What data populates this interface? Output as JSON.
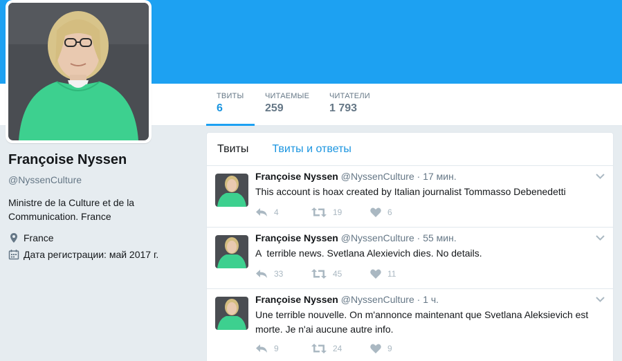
{
  "profile": {
    "name": "Françoise Nyssen",
    "handle": "@NyssenCulture",
    "bio": "Ministre de la Culture et de la Communication. France",
    "location": "France",
    "joined": "Дата регистрации: май 2017 г.",
    "icons": [
      "location-pin-icon",
      "calendar-icon"
    ]
  },
  "stats": [
    {
      "label": "ТВИТЫ",
      "value": "6"
    },
    {
      "label": "ЧИТАЕМЫЕ",
      "value": "259"
    },
    {
      "label": "ЧИТАТЕЛИ",
      "value": "1 793"
    }
  ],
  "tabs": {
    "tweets": "Твиты",
    "replies": "Твиты и ответы"
  },
  "tweets": [
    {
      "name": "Françoise Nyssen",
      "handle": "@NyssenCulture",
      "time": "· 17 мин.",
      "text": "This account is hoax created by Italian journalist Tommasso Debenedetti",
      "replies": "4",
      "retweets": "19",
      "likes": "6"
    },
    {
      "name": "Françoise Nyssen",
      "handle": "@NyssenCulture",
      "time": "· 55 мин.",
      "text": "A  terrible news. Svetlana Alexievich dies. No details.",
      "replies": "33",
      "retweets": "45",
      "likes": "11"
    },
    {
      "name": "Françoise Nyssen",
      "handle": "@NyssenCulture",
      "time": "· 1 ч.",
      "text": "Une terrible nouvelle. On m'annonce maintenant que Svetlana Aleksievich est morte. Je n'ai aucune autre info.",
      "replies": "9",
      "retweets": "24",
      "likes": "9"
    }
  ],
  "colors": {
    "banner": "#1da1f2",
    "accent": "#1b95e0",
    "muted": "#657786",
    "action": "#aab8c2"
  }
}
